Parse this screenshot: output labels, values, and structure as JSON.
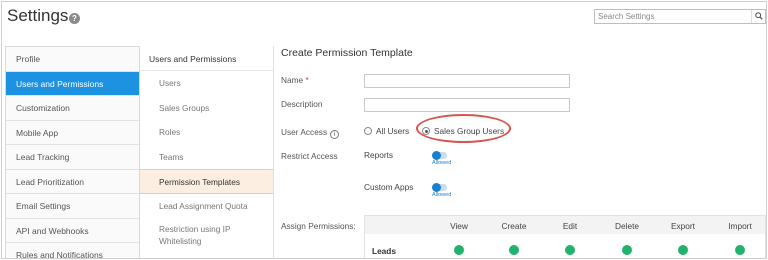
{
  "header": {
    "title": "Settings",
    "help_icon": "?",
    "search_placeholder": "Search Settings",
    "search_icon": "search-icon"
  },
  "menu": {
    "items": [
      {
        "label": "Profile",
        "active": false
      },
      {
        "label": "Users and Permissions",
        "active": true
      },
      {
        "label": "Customization",
        "active": false
      },
      {
        "label": "Mobile App",
        "active": false
      },
      {
        "label": "Lead Tracking",
        "active": false
      },
      {
        "label": "Lead Prioritization",
        "active": false
      },
      {
        "label": "Email Settings",
        "active": false
      },
      {
        "label": "API and Webhooks",
        "active": false
      },
      {
        "label": "Rules and Notifications",
        "active": false
      }
    ]
  },
  "submenu": {
    "heading": "Users and Permissions",
    "items": [
      {
        "label": "Users",
        "active": false
      },
      {
        "label": "Sales Groups",
        "active": false
      },
      {
        "label": "Roles",
        "active": false
      },
      {
        "label": "Teams",
        "active": false
      },
      {
        "label": "Permission Templates",
        "active": true
      },
      {
        "label": "Lead Assignment Quota",
        "active": false
      },
      {
        "label": "Restriction using IP Whitelisting",
        "active": false
      }
    ]
  },
  "form": {
    "title": "Create Permission Template",
    "name_label": "Name",
    "required_mark": "*",
    "name_value": "",
    "description_label": "Description",
    "description_value": "",
    "user_access_label": "User Access",
    "info_icon": "i",
    "access_options": [
      "All Users",
      "Sales Group Users"
    ],
    "access_selected": "Sales Group Users",
    "restrict_access_label": "Restrict Access",
    "restrictions": [
      {
        "label": "Reports",
        "state": "Allowed",
        "on": true
      },
      {
        "label": "Custom Apps",
        "state": "Allowed",
        "on": true
      }
    ],
    "assign_label": "Assign Permissions:"
  },
  "permissions": {
    "columns": [
      "View",
      "Create",
      "Edit",
      "Delete",
      "Export",
      "Import"
    ],
    "rows": [
      {
        "label": "Leads",
        "values": [
          true,
          true,
          true,
          true,
          true,
          true
        ]
      }
    ],
    "granted_color": "#1fb36b"
  },
  "colors": {
    "accent": "#1d92e0",
    "highlight_ring": "#d9534f",
    "toggle_on": "#1a7fd0"
  }
}
